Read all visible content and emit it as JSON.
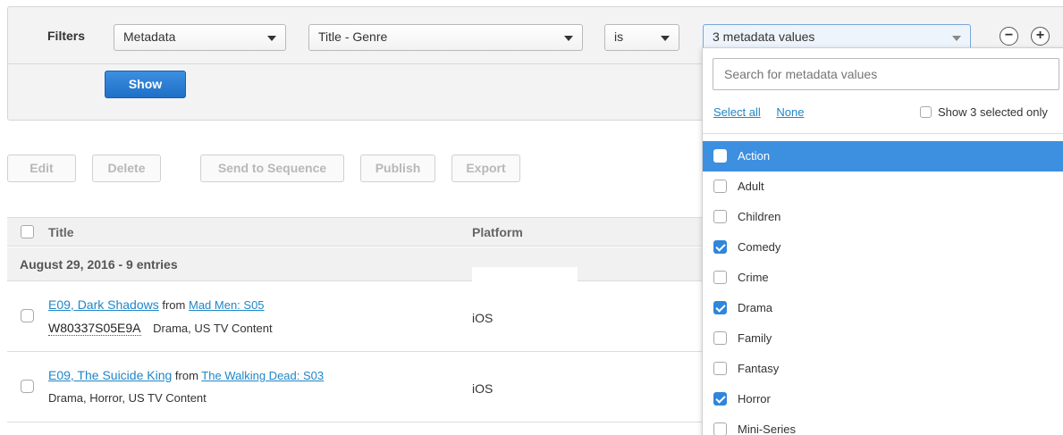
{
  "filters": {
    "label": "Filters",
    "field_select": "Metadata",
    "attribute_select": "Title - Genre",
    "operator_select": "is",
    "values_select": "3 metadata values",
    "remove_symbol": "−",
    "add_symbol": "+",
    "show_button": "Show"
  },
  "actions": {
    "edit": "Edit",
    "delete": "Delete",
    "send_to_sequence": "Send to Sequence",
    "publish": "Publish",
    "export": "Export"
  },
  "table": {
    "columns": {
      "title": "Title",
      "platform": "Platform"
    },
    "group_label": "August 29, 2016 - 9 entries",
    "rows": [
      {
        "title": "E09, Dark Shadows",
        "from": "from",
        "series": "Mad Men: S05",
        "sku": "W80337S05E9A",
        "meta": "Drama, US TV Content",
        "platform": "iOS"
      },
      {
        "title": "E09, The Suicide King",
        "from": "from",
        "series": "The Walking Dead: S03",
        "sku": "",
        "meta": "Drama, Horror, US TV Content",
        "platform": "iOS"
      }
    ]
  },
  "dropdown": {
    "search_placeholder": "Search for metadata values",
    "select_all": "Select all",
    "none": "None",
    "show_selected": "Show 3 selected only",
    "options": [
      {
        "label": "Action",
        "checked": false,
        "active": true
      },
      {
        "label": "Adult",
        "checked": false
      },
      {
        "label": "Children",
        "checked": false
      },
      {
        "label": "Comedy",
        "checked": true
      },
      {
        "label": "Crime",
        "checked": false
      },
      {
        "label": "Drama",
        "checked": true
      },
      {
        "label": "Family",
        "checked": false
      },
      {
        "label": "Fantasy",
        "checked": false
      },
      {
        "label": "Horror",
        "checked": true
      },
      {
        "label": "Mini-Series",
        "checked": false
      }
    ]
  },
  "colors": {
    "primary_blue": "#1e6fc7",
    "link_blue": "#1f86c8",
    "active_row": "#3d8fe0"
  }
}
